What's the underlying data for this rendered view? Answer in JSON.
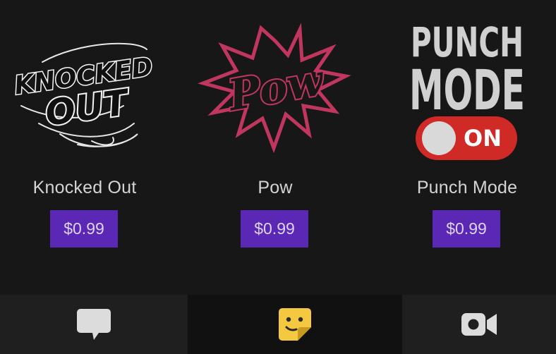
{
  "stickers": [
    {
      "name": "Knocked Out",
      "price": "$0.99",
      "art_text_line1": "KNOCKED",
      "art_text_line2": "OUT",
      "icon": "knocked-out-sticker"
    },
    {
      "name": "Pow",
      "price": "$0.99",
      "art_text": "Pow",
      "icon": "pow-burst-sticker"
    },
    {
      "name": "Punch Mode",
      "price": "$0.99",
      "art_text_line1": "PUNCH",
      "art_text_line2": "MODE",
      "toggle_text": "ON",
      "icon": "punch-mode-toggle-sticker"
    }
  ],
  "tabbar": {
    "tabs": [
      {
        "icon": "chat-bubble-icon",
        "selected": false
      },
      {
        "icon": "sticker-icon",
        "selected": true
      },
      {
        "icon": "video-camera-icon",
        "selected": false
      }
    ]
  },
  "colors": {
    "background": "#171717",
    "price_button": "#5b28b5",
    "pow_pink": "#c0365f",
    "toggle_red": "#cf2a26",
    "sticker_tab_yellow": "#f5c842",
    "tabbar_bg": "#1f1f1f",
    "tabbar_selected_bg": "#111111"
  }
}
